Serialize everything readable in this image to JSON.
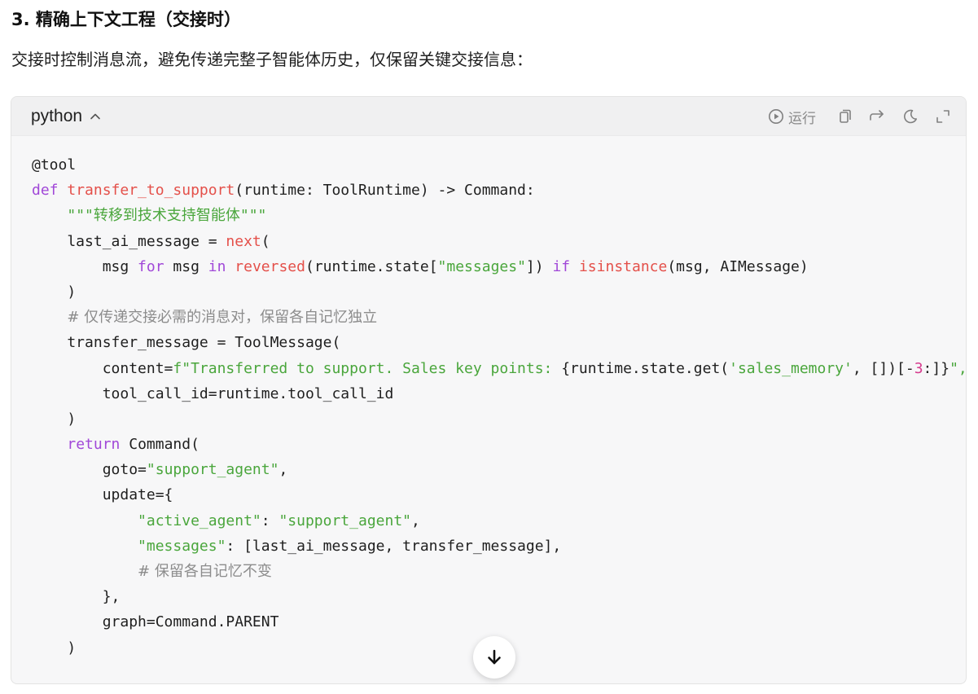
{
  "heading": "3. 精确上下文工程（交接时）",
  "intro": "交接时控制消息流，避免传递完整子智能体历史，仅保留关键交接信息：",
  "code_block": {
    "language": "python",
    "run_label": "运行",
    "icons": {
      "language_toggle": "chevron-up-icon",
      "run": "play-circle-icon",
      "copy": "copy-icon",
      "wrap": "wrap-arrow-icon",
      "theme": "moon-icon",
      "expand": "expand-icon",
      "scroll": "arrow-down-icon"
    },
    "lines": [
      [
        {
          "t": "@tool",
          "c": "plain"
        }
      ],
      [
        {
          "t": "def ",
          "c": "kw"
        },
        {
          "t": "transfer_to_support",
          "c": "fn"
        },
        {
          "t": "(runtime: ToolRuntime) -> Command:",
          "c": "plain"
        }
      ],
      [
        {
          "t": "    ",
          "c": "plain"
        },
        {
          "t": "\"\"\"转移到技术支持智能体\"\"\"",
          "c": "str"
        }
      ],
      [
        {
          "t": "    last_ai_message = ",
          "c": "plain"
        },
        {
          "t": "next",
          "c": "fn"
        },
        {
          "t": "(",
          "c": "plain"
        }
      ],
      [
        {
          "t": "        msg ",
          "c": "plain"
        },
        {
          "t": "for",
          "c": "kw"
        },
        {
          "t": " msg ",
          "c": "plain"
        },
        {
          "t": "in",
          "c": "kw"
        },
        {
          "t": " ",
          "c": "plain"
        },
        {
          "t": "reversed",
          "c": "fn"
        },
        {
          "t": "(runtime.state[",
          "c": "plain"
        },
        {
          "t": "\"messages\"",
          "c": "str"
        },
        {
          "t": "]) ",
          "c": "plain"
        },
        {
          "t": "if",
          "c": "kw"
        },
        {
          "t": " ",
          "c": "plain"
        },
        {
          "t": "isinstance",
          "c": "fn"
        },
        {
          "t": "(msg, AIMessage)",
          "c": "plain"
        }
      ],
      [
        {
          "t": "    )",
          "c": "plain"
        }
      ],
      [
        {
          "t": "    ",
          "c": "plain"
        },
        {
          "t": "# 仅传递交接必需的消息对，保留各自记忆独立",
          "c": "com"
        }
      ],
      [
        {
          "t": "    transfer_message = ToolMessage(",
          "c": "plain"
        }
      ],
      [
        {
          "t": "        content=",
          "c": "plain"
        },
        {
          "t": "f\"Transferred to support. Sales key points: ",
          "c": "str"
        },
        {
          "t": "{runtime.state.get(",
          "c": "plain"
        },
        {
          "t": "'sales_memory'",
          "c": "str"
        },
        {
          "t": ", [])[-",
          "c": "plain"
        },
        {
          "t": "3",
          "c": "num"
        },
        {
          "t": ":]}",
          "c": "plain"
        },
        {
          "t": "\",",
          "c": "str"
        }
      ],
      [
        {
          "t": "        tool_call_id=runtime.tool_call_id",
          "c": "plain"
        }
      ],
      [
        {
          "t": "    )",
          "c": "plain"
        }
      ],
      [
        {
          "t": "    ",
          "c": "plain"
        },
        {
          "t": "return",
          "c": "kw"
        },
        {
          "t": " Command(",
          "c": "plain"
        }
      ],
      [
        {
          "t": "        goto=",
          "c": "plain"
        },
        {
          "t": "\"support_agent\"",
          "c": "str"
        },
        {
          "t": ",",
          "c": "plain"
        }
      ],
      [
        {
          "t": "        update={",
          "c": "plain"
        }
      ],
      [
        {
          "t": "            ",
          "c": "plain"
        },
        {
          "t": "\"active_agent\"",
          "c": "str"
        },
        {
          "t": ": ",
          "c": "plain"
        },
        {
          "t": "\"support_agent\"",
          "c": "str"
        },
        {
          "t": ",",
          "c": "plain"
        }
      ],
      [
        {
          "t": "            ",
          "c": "plain"
        },
        {
          "t": "\"messages\"",
          "c": "str"
        },
        {
          "t": ": [last_ai_message, transfer_message],",
          "c": "plain"
        }
      ],
      [
        {
          "t": "            ",
          "c": "plain"
        },
        {
          "t": "# 保留各自记忆不变",
          "c": "com"
        }
      ],
      [
        {
          "t": "        },",
          "c": "plain"
        }
      ],
      [
        {
          "t": "        graph=Command.PARENT",
          "c": "plain"
        }
      ],
      [
        {
          "t": "    )",
          "c": "plain"
        }
      ]
    ]
  }
}
